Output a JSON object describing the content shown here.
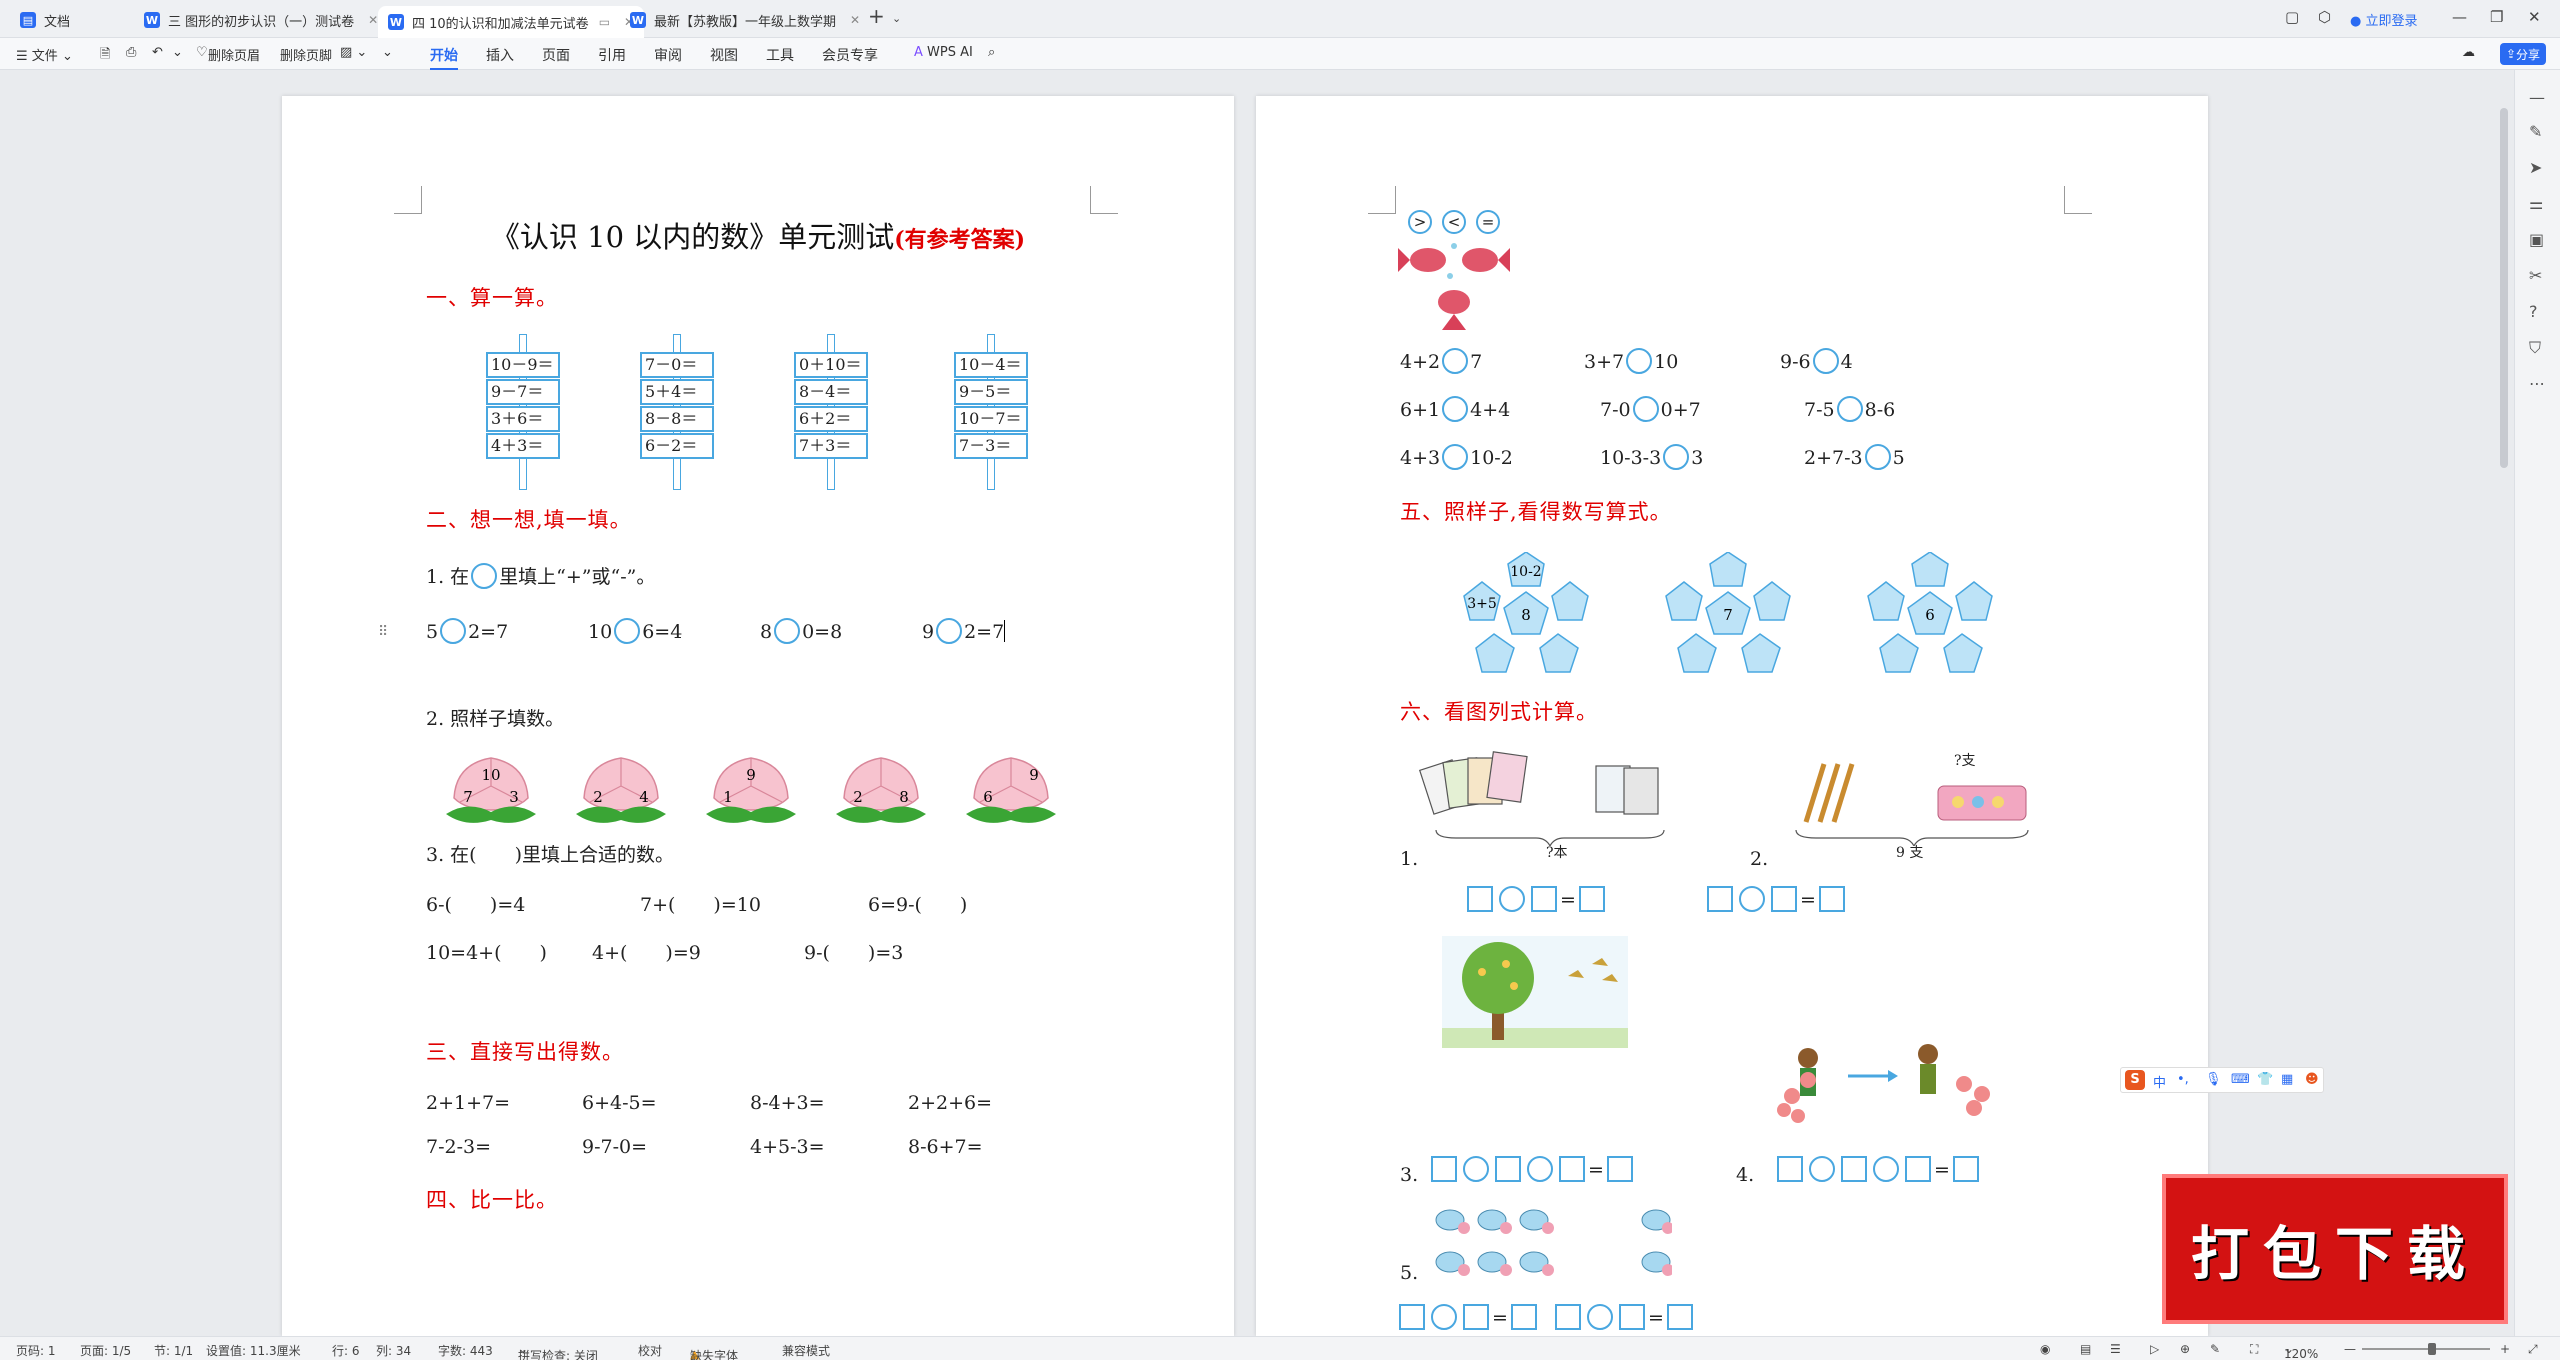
{
  "tabs": {
    "home": "文档",
    "tab1": "三 图形的初步认识（一）测试卷",
    "tab2": "四 10的认识和加减法单元试卷",
    "tab3": "最新【苏教版】一年级上数学期",
    "login": "立即登录"
  },
  "toolbar": {
    "file": "文件",
    "del_header": "删除页眉",
    "del_footer": "删除页脚",
    "menus": [
      "开始",
      "插入",
      "页面",
      "引用",
      "审阅",
      "视图",
      "工具",
      "会员专享"
    ],
    "wps_ai": "WPS AI",
    "share": "分享"
  },
  "left_page": {
    "title": "《认识 10 以内的数》单元测试",
    "title_note": "(有参考答案)",
    "sec1": "一、算一算。",
    "skewers": [
      [
        "10－9＝",
        "9－7＝",
        "3＋6＝",
        "4＋3＝"
      ],
      [
        "7－0＝",
        "5＋4＝",
        "8－8＝",
        "6－2＝"
      ],
      [
        "0＋10＝",
        "8－4＝",
        "6＋2＝",
        "7＋3＝"
      ],
      [
        "10－4＝",
        "9－5＝",
        "10－7＝",
        "7－3＝"
      ]
    ],
    "sec2": "二、想一想,填一填。",
    "q1_a": "1. 在",
    "q1_b": "里填上“+”或“-”。",
    "q1_items": [
      [
        "5",
        "2=7"
      ],
      [
        "10",
        "6=4"
      ],
      [
        "8",
        "0=8"
      ],
      [
        "9",
        "2=7"
      ]
    ],
    "q2": "2. 照样子填数。",
    "peaches": [
      [
        "10",
        "7",
        "3"
      ],
      [
        "",
        "2",
        "4"
      ],
      [
        "9",
        "1",
        ""
      ],
      [
        "",
        "2",
        "8"
      ],
      [
        "9",
        "6",
        ""
      ]
    ],
    "q3": "3. 在(　　)里填上合适的数。",
    "q3_items": [
      "6-(　　)=4",
      "7+(　　)=10",
      "6=9-(　　)",
      "10=4+(　　)",
      "4+(　　)=9",
      "9-(　　)=3"
    ],
    "sec3": "三、直接写出得数。",
    "sec3_items": [
      "2+1+7=",
      "6+4-5=",
      "8-4+3=",
      "2+2+6=",
      "7-2-3=",
      "9-7-0=",
      "4+5-3=",
      "8-6+7="
    ],
    "sec4": "四、比一比。"
  },
  "right_page": {
    "symbols": [
      ">",
      "<",
      "="
    ],
    "compare": [
      [
        "4+2",
        "7"
      ],
      [
        "3+7",
        "10"
      ],
      [
        "9-6",
        "4"
      ],
      [
        "6+1",
        "4+4"
      ],
      [
        "7-0",
        "0+7"
      ],
      [
        "7-5",
        "8-6"
      ],
      [
        "4+3",
        "10-2"
      ],
      [
        "10-3-3",
        "3"
      ],
      [
        "2+7-3",
        "5"
      ]
    ],
    "sec5": "五、照样子,看得数写算式。",
    "flowers": [
      {
        "center": "8",
        "petals": [
          "10-2",
          "3+5"
        ]
      },
      {
        "center": "7",
        "petals": []
      },
      {
        "center": "6",
        "petals": []
      }
    ],
    "sec6": "六、看图列式计算。",
    "p1": "1.",
    "p1_label": "?本",
    "p2": "2.",
    "p2_q": "?支",
    "p2_label": "9 支",
    "p3": "3.",
    "p4": "4.",
    "p5": "5."
  },
  "status": {
    "page": "页码: 1",
    "pages": "页面: 1/5",
    "section": "节: 1/1",
    "setting": "设置值: 11.3厘米",
    "row": "行: 6",
    "col": "列: 34",
    "words": "字数: 443",
    "spell": "拼写检查: 关闭",
    "proof": "校对",
    "font_missing": "缺失字体",
    "compat": "兼容模式",
    "zoom": "120%"
  },
  "ime": [
    "中",
    "•,",
    "🎤",
    "⌨"
  ],
  "download_badge": "打包下载"
}
